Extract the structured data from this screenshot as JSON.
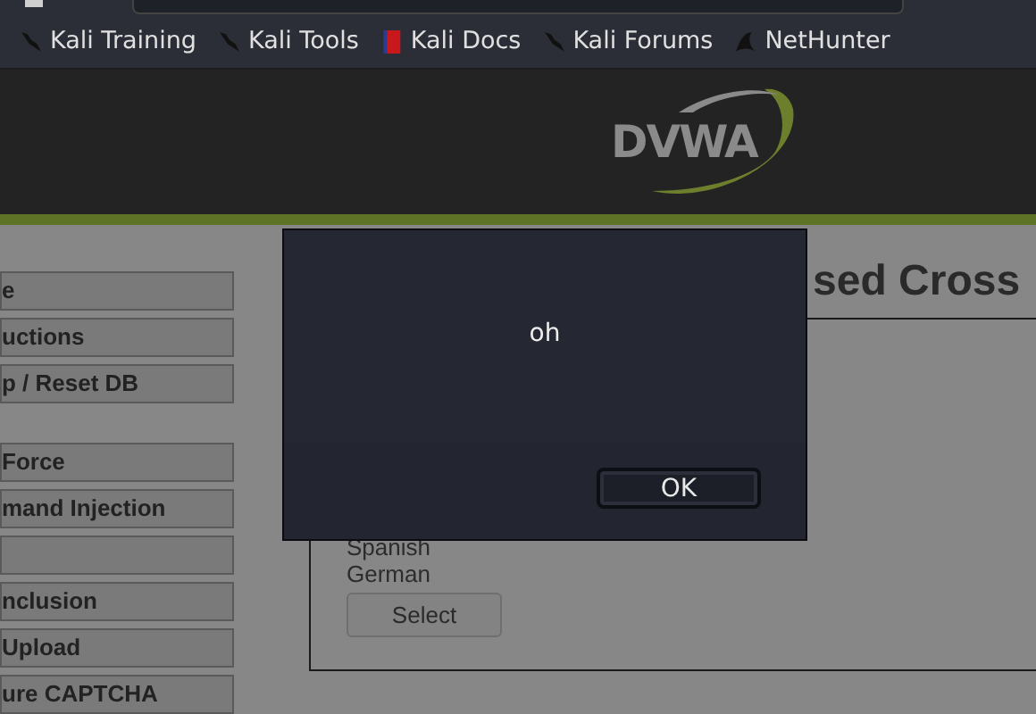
{
  "bookmarks": [
    {
      "label": "Kali Training",
      "kind": "kali"
    },
    {
      "label": "Kali Tools",
      "kind": "kali"
    },
    {
      "label": "Kali Docs",
      "kind": "docs"
    },
    {
      "label": "Kali Forums",
      "kind": "kali"
    },
    {
      "label": "NetHunter",
      "kind": "nethunter"
    }
  ],
  "header": {
    "logo": "DVWA"
  },
  "sidebar": {
    "groups": [
      [
        {
          "kind": "text",
          "label": "e"
        },
        {
          "kind": "text",
          "label": "uctions"
        },
        {
          "kind": "text",
          "label": "p / Reset DB"
        }
      ],
      [
        {
          "kind": "text",
          "label": "Force"
        },
        {
          "kind": "text",
          "label": "mand Injection"
        },
        {
          "kind": "blank"
        },
        {
          "kind": "text",
          "label": "nclusion"
        },
        {
          "kind": "text",
          "label": "Upload"
        },
        {
          "kind": "text",
          "label": "ure CAPTCHA"
        }
      ]
    ]
  },
  "main": {
    "heading": "sed Cross",
    "options": [
      "Spanish",
      "German"
    ],
    "button": "Select"
  },
  "dialog": {
    "message": "oh",
    "button": "OK"
  }
}
